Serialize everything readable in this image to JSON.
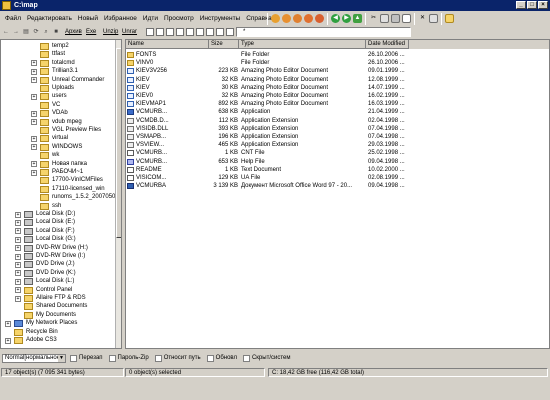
{
  "window": {
    "title": "C:\\map"
  },
  "menu": [
    "Файл",
    "Редактировать",
    "Новый",
    "Избранное",
    "Идти",
    "Просмотр",
    "Инструменты",
    "Справка"
  ],
  "toolbar2": {
    "buttons": [
      "Архив",
      "Ехе",
      "Unzip",
      "Unrar"
    ],
    "path": "*"
  },
  "tree": [
    {
      "label": "temp2",
      "depth": 3,
      "expander": "",
      "icon": "folder"
    },
    {
      "label": "ttfast",
      "depth": 3,
      "expander": "",
      "icon": "folder"
    },
    {
      "label": "totalcmd",
      "depth": 3,
      "expander": "+",
      "icon": "folder"
    },
    {
      "label": "Trillian3.1",
      "depth": 3,
      "expander": "+",
      "icon": "folder"
    },
    {
      "label": "Unreal Commander",
      "depth": 3,
      "expander": "+",
      "icon": "folder"
    },
    {
      "label": "Uploads",
      "depth": 3,
      "expander": "",
      "icon": "folder"
    },
    {
      "label": "users",
      "depth": 3,
      "expander": "+",
      "icon": "folder"
    },
    {
      "label": "VC",
      "depth": 3,
      "expander": "",
      "icon": "folder"
    },
    {
      "label": "VDAb",
      "depth": 3,
      "expander": "+",
      "icon": "folder"
    },
    {
      "label": "vdub mpeg",
      "depth": 3,
      "expander": "+",
      "icon": "folder"
    },
    {
      "label": "VGL Preview Files",
      "depth": 3,
      "expander": "",
      "icon": "folder"
    },
    {
      "label": "virtual",
      "depth": 3,
      "expander": "+",
      "icon": "folder"
    },
    {
      "label": "WINDOWS",
      "depth": 3,
      "expander": "+",
      "icon": "folder"
    },
    {
      "label": "wk",
      "depth": 3,
      "expander": "",
      "icon": "folder"
    },
    {
      "label": "Новая папка",
      "depth": 3,
      "expander": "+",
      "icon": "folder"
    },
    {
      "label": "РАБОЧИ~1",
      "depth": 3,
      "expander": "+",
      "icon": "folder"
    },
    {
      "label": "17700-VinICMFiles",
      "depth": 3,
      "expander": "",
      "icon": "folder"
    },
    {
      "label": "17110-licensed_win",
      "depth": 3,
      "expander": "",
      "icon": "folder"
    },
    {
      "label": "runoms_1.5.2_20070504",
      "depth": 3,
      "expander": "",
      "icon": "folder"
    },
    {
      "label": "ssh",
      "depth": 3,
      "expander": "",
      "icon": "folder"
    },
    {
      "label": "Local Disk (D:)",
      "depth": 1,
      "expander": "+",
      "icon": "drive"
    },
    {
      "label": "Local Disk (E:)",
      "depth": 1,
      "expander": "+",
      "icon": "drive"
    },
    {
      "label": "Local Disk (F:)",
      "depth": 1,
      "expander": "+",
      "icon": "drive"
    },
    {
      "label": "Local Disk (G:)",
      "depth": 1,
      "expander": "+",
      "icon": "drive"
    },
    {
      "label": "DVD-RW Drive (H:)",
      "depth": 1,
      "expander": "+",
      "icon": "drive"
    },
    {
      "label": "DVD-RW Drive (I:)",
      "depth": 1,
      "expander": "+",
      "icon": "drive"
    },
    {
      "label": "DVD Drive (J:)",
      "depth": 1,
      "expander": "+",
      "icon": "drive"
    },
    {
      "label": "DVD Drive (K:)",
      "depth": 1,
      "expander": "+",
      "icon": "drive"
    },
    {
      "label": "Local Disk (L:)",
      "depth": 1,
      "expander": "+",
      "icon": "drive"
    },
    {
      "label": "Control Panel",
      "depth": 1,
      "expander": "+",
      "icon": "folder"
    },
    {
      "label": "Allaire FTP & RDS",
      "depth": 1,
      "expander": "+",
      "icon": "folder"
    },
    {
      "label": "Shared Documents",
      "depth": 1,
      "expander": "",
      "icon": "folder"
    },
    {
      "label": "My Documents",
      "depth": 1,
      "expander": "",
      "icon": "folder"
    },
    {
      "label": "My Network Places",
      "depth": 0,
      "expander": "+",
      "icon": "net"
    },
    {
      "label": "Recycle Bin",
      "depth": 0,
      "expander": "",
      "icon": "folder"
    },
    {
      "label": "Adobe CS3",
      "depth": 0,
      "expander": "+",
      "icon": "folder"
    }
  ],
  "list": {
    "headers": {
      "name": "Name",
      "size": "Size",
      "type": "Type",
      "modified": "Date Modified"
    },
    "rows": [
      {
        "name": "FONTS",
        "size": "",
        "type": "File Folder",
        "modified": "26.10.2006 ...",
        "icon": "folder"
      },
      {
        "name": "VINV0",
        "size": "",
        "type": "File Folder",
        "modified": "26.10.2006 ...",
        "icon": "folder"
      },
      {
        "name": "KIEV3V256",
        "size": "223 KB",
        "type": "Amazing Photo Editor Document",
        "modified": "09.01.1999 ...",
        "icon": "img"
      },
      {
        "name": "KIEV",
        "size": "32 KB",
        "type": "Amazing Photo Editor Document",
        "modified": "12.08.1999 ...",
        "icon": "img"
      },
      {
        "name": "KIEV",
        "size": "30 KB",
        "type": "Amazing Photo Editor Document",
        "modified": "14.07.1999 ...",
        "icon": "img"
      },
      {
        "name": "KIEV0",
        "size": "32 KB",
        "type": "Amazing Photo Editor Document",
        "modified": "16.02.1999 ...",
        "icon": "img"
      },
      {
        "name": "KIEVMAP1",
        "size": "892 KB",
        "type": "Amazing Photo Editor Document",
        "modified": "16.03.1999 ...",
        "icon": "img"
      },
      {
        "name": "VCMURB...",
        "size": "638 KB",
        "type": "Application",
        "modified": "21.04.1999 ...",
        "icon": "app"
      },
      {
        "name": "VCMDB.D...",
        "size": "112 KB",
        "type": "Application Extension",
        "modified": "02.04.1998 ...",
        "icon": "dll"
      },
      {
        "name": "VISIDB.DLL",
        "size": "393 KB",
        "type": "Application Extension",
        "modified": "07.04.1998 ...",
        "icon": "dll"
      },
      {
        "name": "VSMAPB...",
        "size": "196 KB",
        "type": "Application Extension",
        "modified": "07.04.1998 ...",
        "icon": "dll"
      },
      {
        "name": "VSVIEW...",
        "size": "465 KB",
        "type": "Application Extension",
        "modified": "29.03.1998 ...",
        "icon": "dll"
      },
      {
        "name": "VCMURB...",
        "size": "1 KB",
        "type": "CNT File",
        "modified": "25.02.1998 ...",
        "icon": "doc"
      },
      {
        "name": "VCMURB...",
        "size": "653 KB",
        "type": "Help File",
        "modified": "09.04.1998 ...",
        "icon": "help"
      },
      {
        "name": "README",
        "size": "1 KB",
        "type": "Text Document",
        "modified": "10.02.2000 ...",
        "icon": "doc"
      },
      {
        "name": "VISICOM...",
        "size": "129 KB",
        "type": "UA File",
        "modified": "02.08.1999 ...",
        "icon": "doc"
      },
      {
        "name": "VCMURBA",
        "size": "3 139 KB",
        "type": "Документ Microsoft Office Word 97 - 20...",
        "modified": "09.04.1998 ...",
        "icon": "word"
      }
    ]
  },
  "options": {
    "mode": "Normal[нормальное",
    "checks": [
      "Перезап",
      "Пароль-Zip",
      "Относит путь",
      "Обновл",
      "Скрыт/систем"
    ]
  },
  "status": {
    "objects": "17 object(s) (7 095 341 bytes)",
    "selected": "0 object(s) selected",
    "disk": "C: 18,42 GB free (116,42 GB total)"
  }
}
